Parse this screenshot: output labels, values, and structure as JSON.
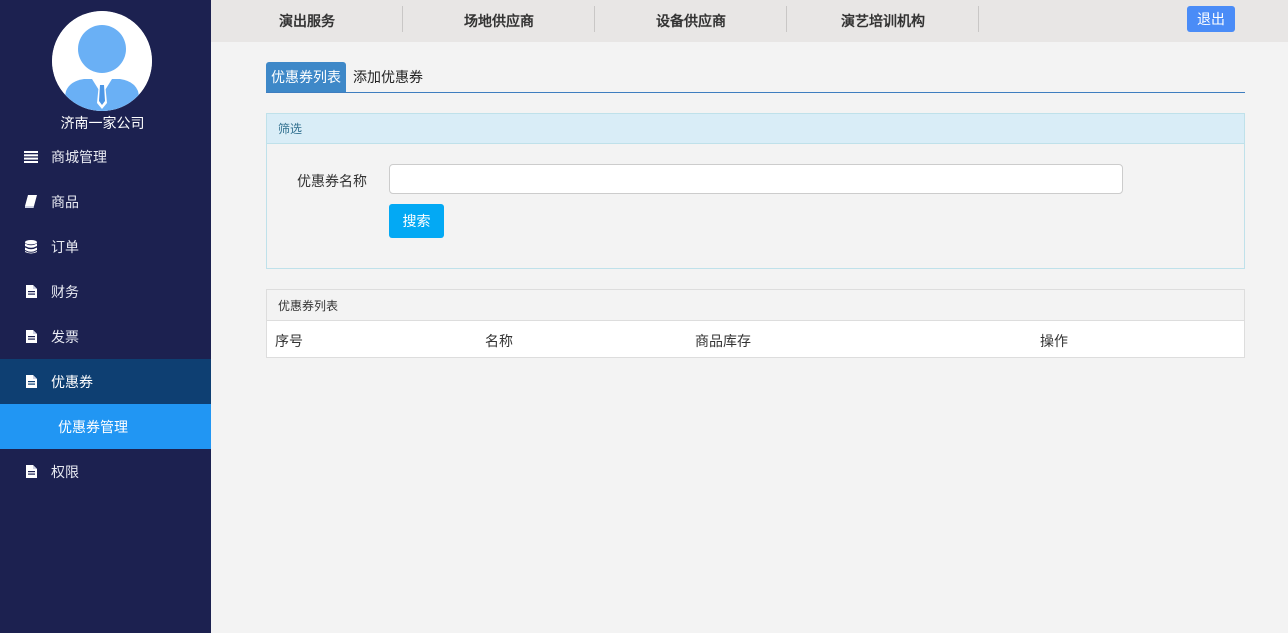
{
  "sidebar": {
    "company_name": "济南一家公司",
    "items": [
      {
        "label": "商城管理",
        "icon": "list-icon"
      },
      {
        "label": "商品",
        "icon": "book-icon"
      },
      {
        "label": "订单",
        "icon": "database-icon"
      },
      {
        "label": "财务",
        "icon": "file-icon"
      },
      {
        "label": "发票",
        "icon": "file-icon"
      },
      {
        "label": "优惠券",
        "icon": "file-icon"
      },
      {
        "label": "优惠券管理",
        "icon": ""
      },
      {
        "label": "权限",
        "icon": "file-icon"
      }
    ]
  },
  "topnav": {
    "items": [
      "演出服务",
      "场地供应商",
      "设备供应商",
      "演艺培训机构"
    ],
    "logout_label": "退出"
  },
  "tabs": {
    "list_label": "优惠券列表",
    "add_label": "添加优惠券"
  },
  "filter": {
    "heading": "筛选",
    "name_label": "优惠券名称",
    "name_value": "",
    "search_label": "搜索"
  },
  "list": {
    "heading": "优惠券列表",
    "columns": [
      "序号",
      "名称",
      "商品库存",
      "操作"
    ]
  },
  "colors": {
    "sidebar_bg": "#1c2150",
    "active_menu": "#0e3f72",
    "submenu_active": "#2196f3",
    "search_button": "#03a9f4",
    "logout_button": "#4a8cf7"
  }
}
